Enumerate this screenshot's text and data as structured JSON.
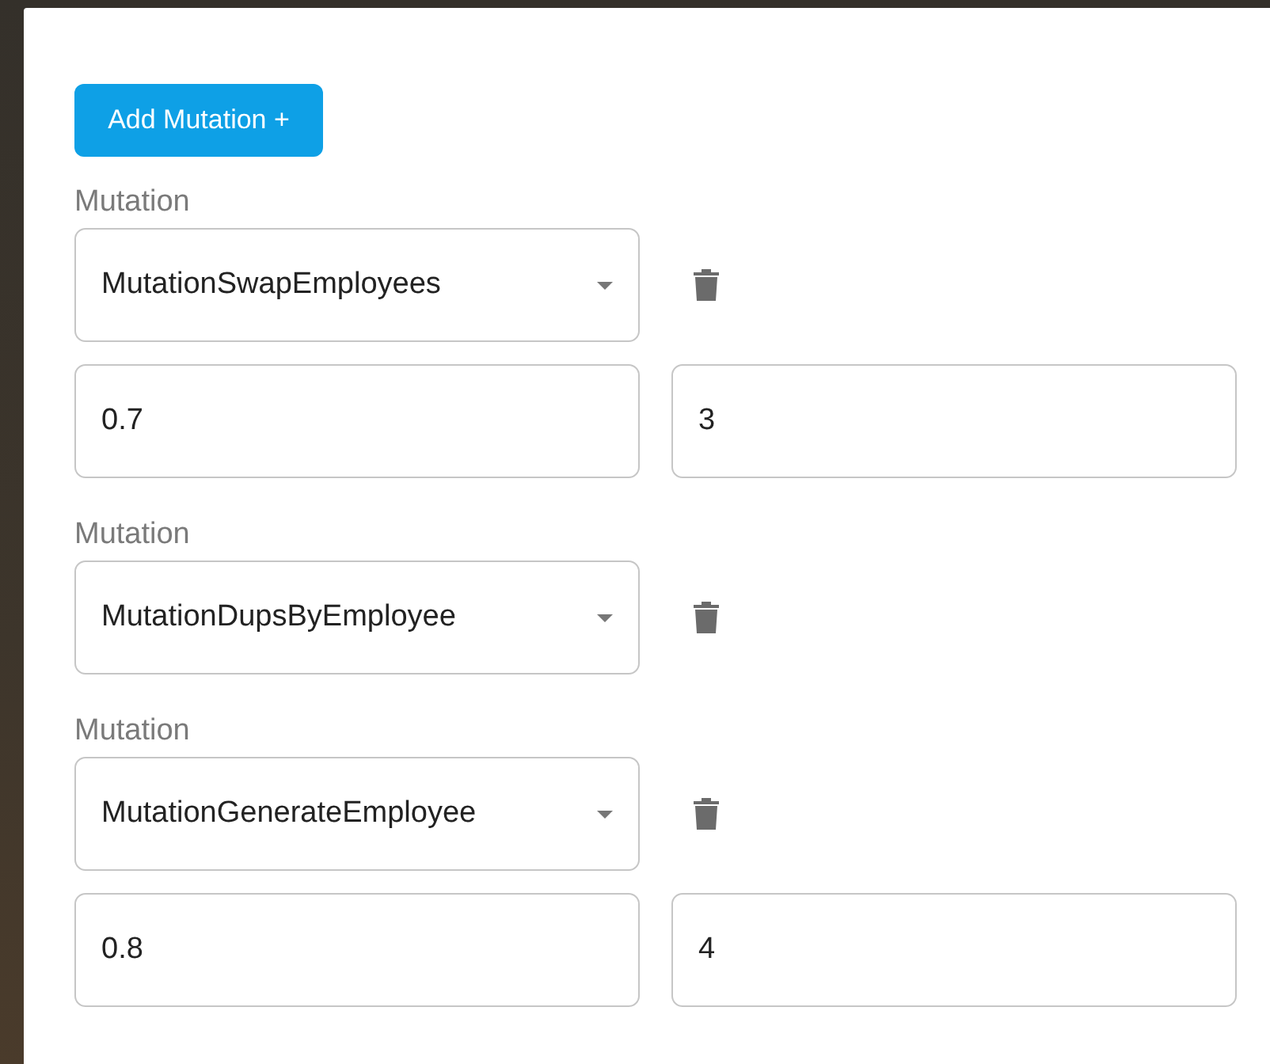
{
  "add_button": {
    "label": "Add Mutation +"
  },
  "mutations": [
    {
      "label": "Mutation",
      "value": "MutationSwapEmployees",
      "params": [
        "0.7",
        "3"
      ]
    },
    {
      "label": "Mutation",
      "value": "MutationDupsByEmployee"
    },
    {
      "label": "Mutation",
      "value": "MutationGenerateEmployee",
      "params": [
        "0.8",
        "4"
      ]
    }
  ]
}
